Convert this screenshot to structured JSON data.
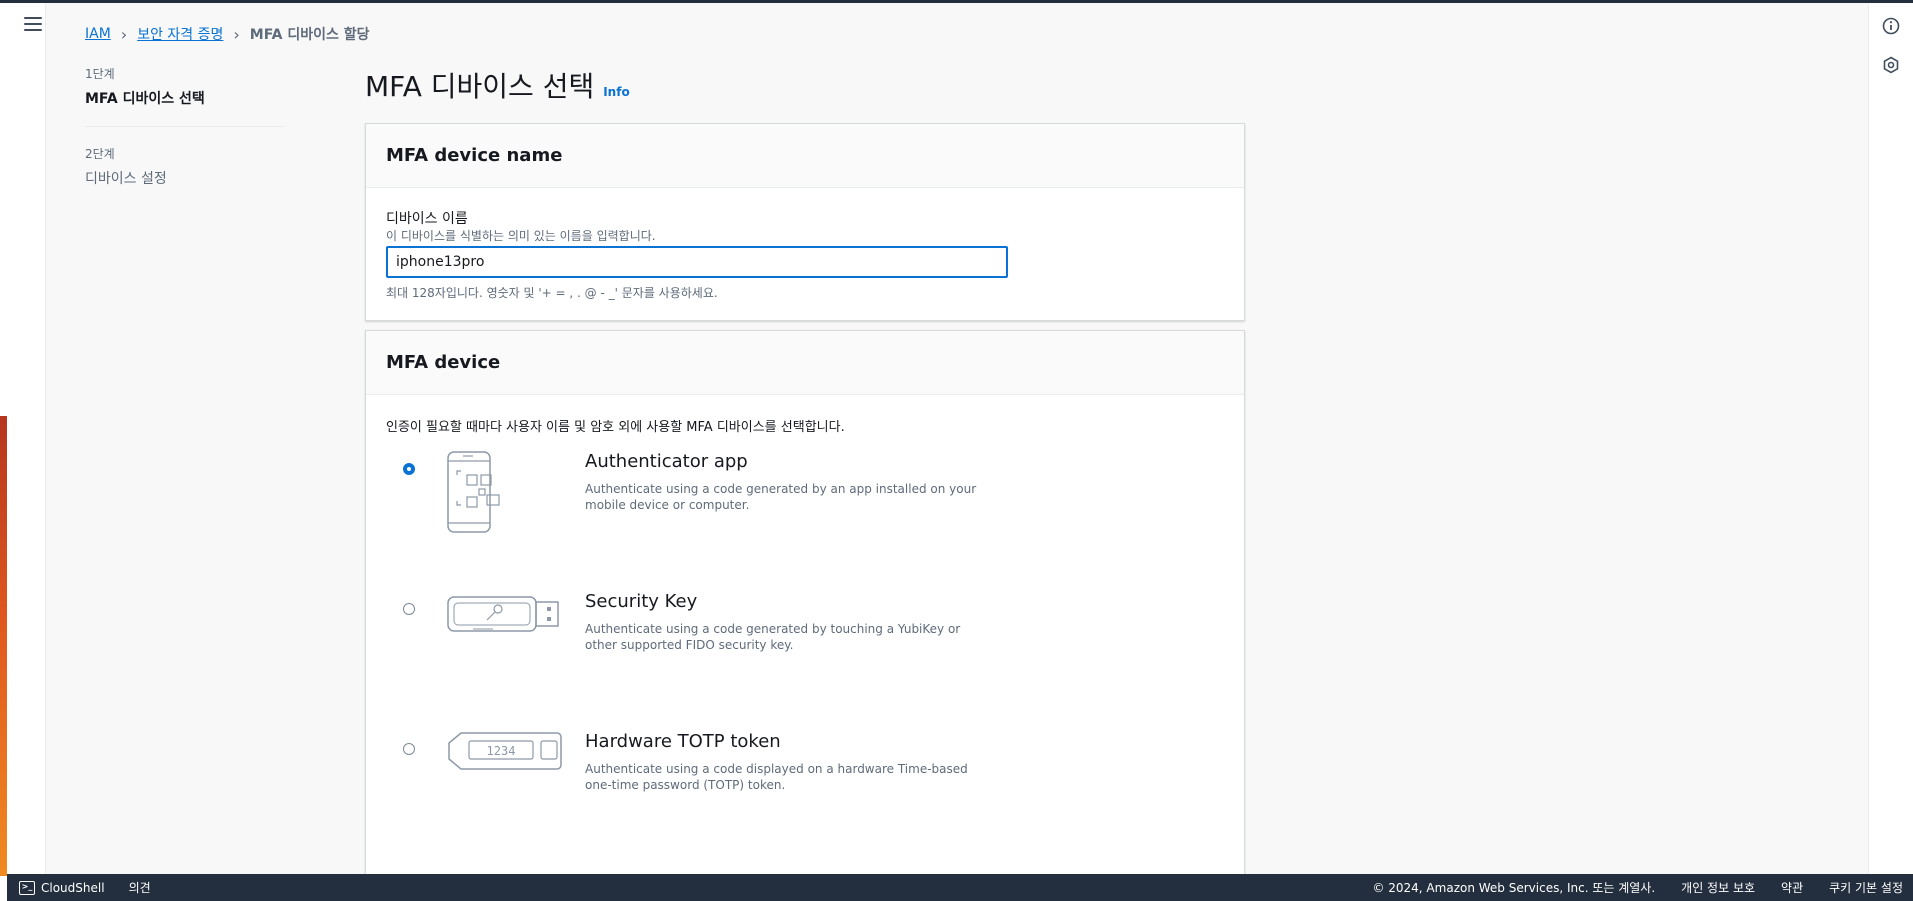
{
  "breadcrumb": {
    "items": [
      "IAM",
      "보안 자격 증명"
    ],
    "current": "MFA 디바이스 할당"
  },
  "steps": [
    {
      "number": "1단계",
      "title": "MFA 디바이스 선택"
    },
    {
      "number": "2단계",
      "title": "디바이스 설정"
    }
  ],
  "page": {
    "title": "MFA 디바이스 선택",
    "info": "Info"
  },
  "device_name_card": {
    "header": "MFA device name",
    "label": "디바이스 이름",
    "description": "이 디바이스를 식별하는 의미 있는 이름을 입력합니다.",
    "value": "iphone13pro",
    "constraint": "최대 128자입니다. 영숫자 및 '+ = , . @ - _' 문자를 사용하세요."
  },
  "mfa_device_card": {
    "header": "MFA device",
    "description": "인증이 필요할 때마다 사용자 이름 및 암호 외에 사용할 MFA 디바이스를 선택합니다.",
    "options": [
      {
        "title": "Authenticator app",
        "description": "Authenticate using a code generated by an app installed on your mobile device or computer.",
        "selected": true,
        "icon": "phone-qr-icon"
      },
      {
        "title": "Security Key",
        "description": "Authenticate using a code generated by touching a YubiKey or other supported FIDO security key.",
        "selected": false,
        "icon": "security-key-icon"
      },
      {
        "title": "Hardware TOTP token",
        "description": "Authenticate using a code displayed on a hardware Time-based one-time password (TOTP) token.",
        "selected": false,
        "icon": "totp-token-icon",
        "token_display": "1234"
      }
    ]
  },
  "footer": {
    "cloudshell": "CloudShell",
    "feedback": "의견",
    "copyright": "© 2024, Amazon Web Services, Inc. 또는 계열사.",
    "privacy": "개인 정보 보호",
    "terms": "약관",
    "cookies": "쿠키 기본 설정"
  },
  "colors": {
    "accent": "#0972d3",
    "footer_bg": "#232f3e",
    "page_bg": "#f8f8f8"
  }
}
